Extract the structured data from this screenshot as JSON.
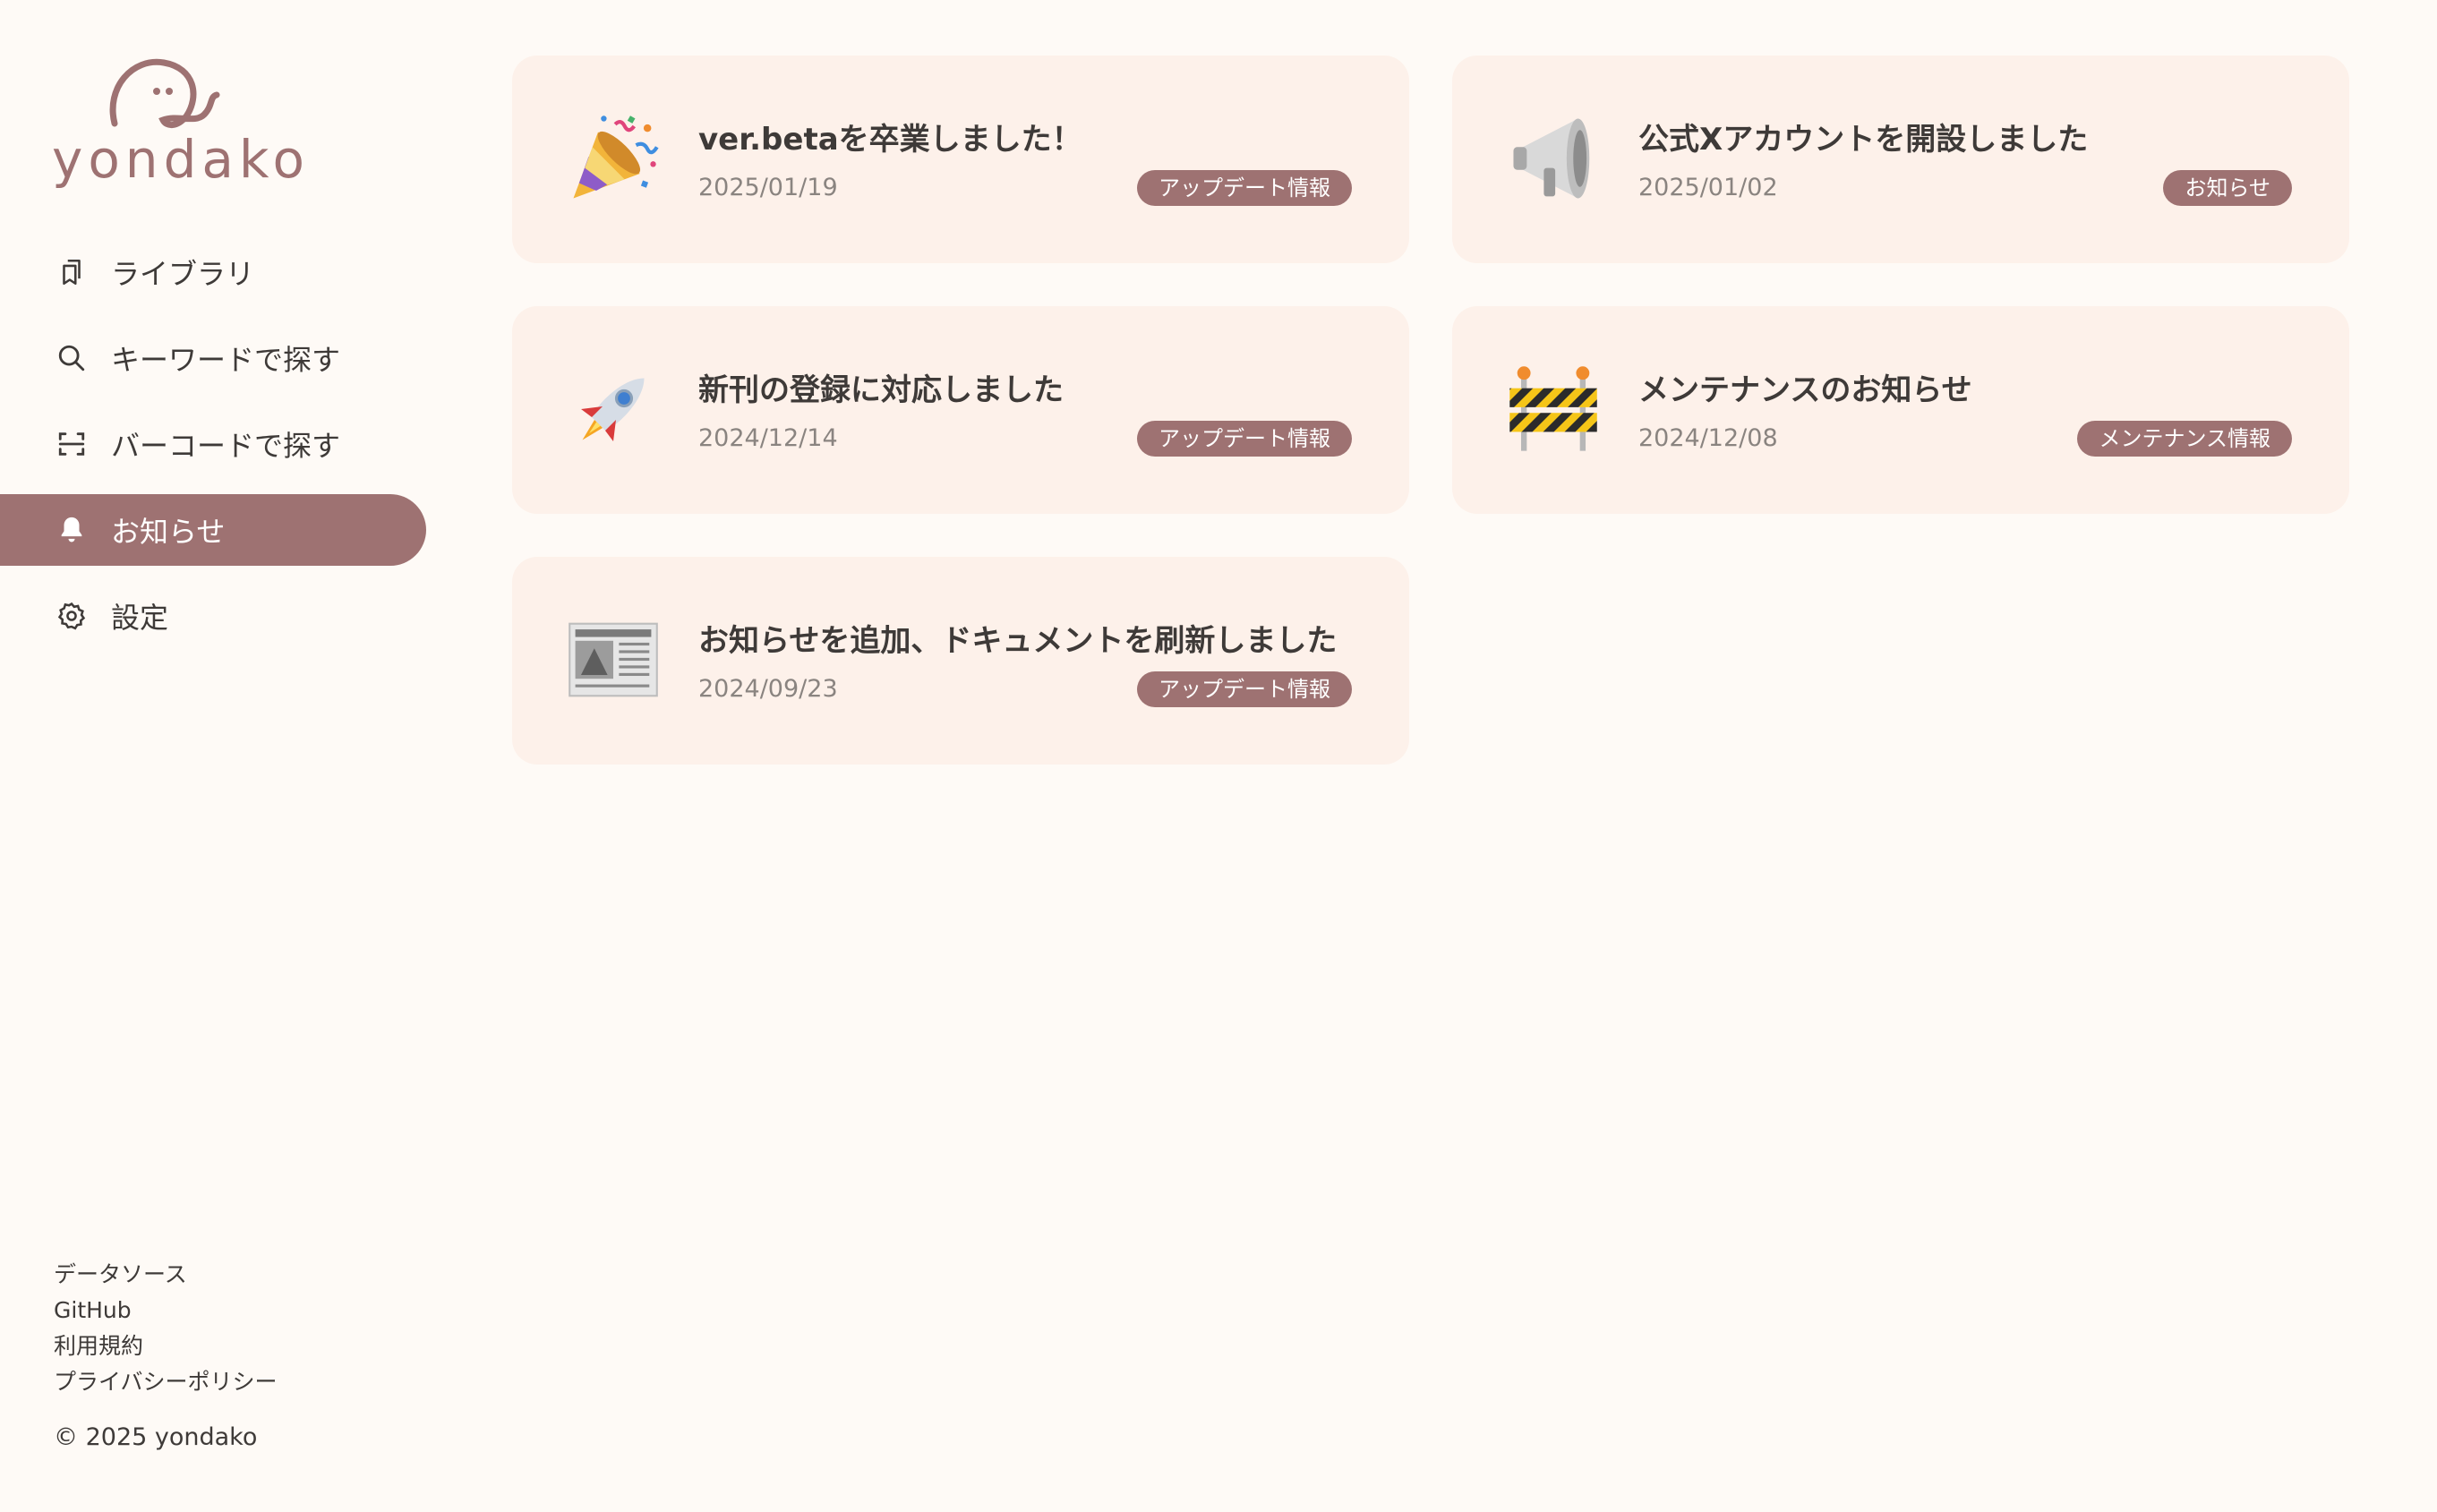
{
  "brand": {
    "name": "yondako",
    "accent": "#9e7272"
  },
  "nav": {
    "items": [
      {
        "label": "ライブラリ",
        "icon": "bookmark-icon",
        "active": false
      },
      {
        "label": "キーワードで探す",
        "icon": "search-icon",
        "active": false
      },
      {
        "label": "バーコードで探す",
        "icon": "barcode-scan-icon",
        "active": false
      },
      {
        "label": "お知らせ",
        "icon": "bell-icon",
        "active": true
      },
      {
        "label": "設定",
        "icon": "gear-icon",
        "active": false
      }
    ]
  },
  "footer": {
    "links": [
      "データソース",
      "GitHub",
      "利用規約",
      "プライバシーポリシー"
    ],
    "copyright": "© 2025 yondako"
  },
  "news": [
    {
      "title": "ver.betaを卒業しました！",
      "date": "2025/01/19",
      "tag": "アップデート情報",
      "icon": "party-popper-icon"
    },
    {
      "title": "公式Xアカウントを開設しました",
      "date": "2025/01/02",
      "tag": "お知らせ",
      "icon": "megaphone-icon"
    },
    {
      "title": "新刊の登録に対応しました",
      "date": "2024/12/14",
      "tag": "アップデート情報",
      "icon": "rocket-icon"
    },
    {
      "title": "メンテナンスのお知らせ",
      "date": "2024/12/08",
      "tag": "メンテナンス情報",
      "icon": "construction-icon"
    },
    {
      "title": "お知らせを追加、ドキュメントを刷新しました",
      "date": "2024/09/23",
      "tag": "アップデート情報",
      "icon": "newspaper-icon"
    }
  ]
}
